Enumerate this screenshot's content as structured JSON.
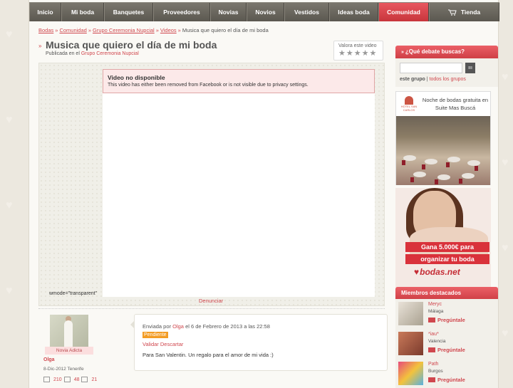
{
  "nav": {
    "items": [
      "Inicio",
      "Mi boda",
      "Banquetes",
      "Proveedores",
      "Novias",
      "Novios",
      "Vestidos",
      "Ideas boda",
      "Comunidad",
      "Tienda"
    ],
    "active": "Comunidad"
  },
  "breadcrumb": {
    "items": [
      "Bodas",
      "Comunidad",
      "Grupo Ceremonia Nupcial",
      "Videos"
    ],
    "current": "Musica que quiero el día de mi boda"
  },
  "page": {
    "title": "Musica que quiero el día de mi boda",
    "published_prefix": "Publicada en el",
    "published_group": "Grupo Ceremonia Nupcial"
  },
  "rating": {
    "label": "Valora este video",
    "stars_total": 5,
    "stars_filled": 0
  },
  "video": {
    "error_title": "Video no disponible",
    "error_message": "This video has either been removed from Facebook or is not visible due to privacy settings.",
    "wmode_text": "wmode=\"transparent\""
  },
  "report_link": "Denunciar",
  "author": {
    "badge": "Novia Adicta",
    "name": "Olga",
    "meta": "8-Dic-2012 Tenerife",
    "stats": [
      "210",
      "48",
      "21"
    ]
  },
  "comment": {
    "sent_prefix": "Enviada por",
    "sent_author": "Olga",
    "sent_suffix": "el 6 de Febrero de 2013 a las 22:58",
    "status": "Pendiente",
    "validate": "Validar",
    "discard": "Descartar",
    "text": "Para San Valentin. Un regalo para el amor de mi vida :)"
  },
  "sidebar": {
    "debate_header": "¿Qué debate buscas?",
    "search_button": "ııı",
    "scope_active": "este grupo",
    "scope_sep": "|",
    "scope_other": "todos los grupos",
    "ad1_logo": "HOTEL SAN CARLOS",
    "ad1_text": "Noche de bodas gratuita en Suite Mas Buscá",
    "ad2_line1": "Gana 5.000€ para",
    "ad2_line2": "organizar tu boda",
    "ad2_brand": "bodas.net",
    "members_header": "Miembros destacados",
    "members": [
      {
        "name": "Meryc",
        "location": "Málaga",
        "action": "Pregúntale"
      },
      {
        "name": "*iau*",
        "location": "Valencia",
        "action": "Pregúntale"
      },
      {
        "name": "Path",
        "location": "Burgos",
        "action": "Pregúntale"
      }
    ]
  },
  "colors": {
    "brand": "#d0474e",
    "nav": "#6b675f",
    "pending": "#f39c24"
  }
}
